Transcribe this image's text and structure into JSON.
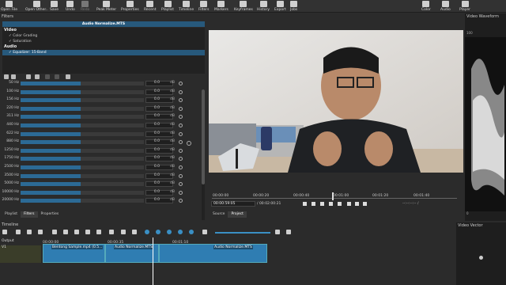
{
  "toolbar": {
    "items": [
      {
        "label": "Open File",
        "icon": "folder-icon"
      },
      {
        "label": "Open Other..",
        "icon": "open-other-icon"
      },
      {
        "label": "Save",
        "icon": "save-icon"
      },
      {
        "label": "Undo",
        "icon": "undo-icon"
      },
      {
        "label": "Redo",
        "icon": "redo-icon"
      },
      {
        "label": "Peak Meter",
        "icon": "peak-meter-icon"
      },
      {
        "label": "Properties",
        "icon": "properties-icon"
      },
      {
        "label": "Recent",
        "icon": "recent-icon"
      },
      {
        "label": "Playlist",
        "icon": "playlist-icon"
      },
      {
        "label": "Timeline",
        "icon": "timeline-icon"
      },
      {
        "label": "Filters",
        "icon": "filters-icon"
      },
      {
        "label": "Markers",
        "icon": "markers-icon"
      },
      {
        "label": "Keyframes",
        "icon": "keyframes-icon"
      },
      {
        "label": "History",
        "icon": "history-icon"
      },
      {
        "label": "Export",
        "icon": "export-icon"
      },
      {
        "label": "Jobs",
        "icon": "jobs-icon"
      }
    ],
    "right": [
      {
        "label": "Color"
      },
      {
        "label": "Audio"
      },
      {
        "label": "Player"
      }
    ]
  },
  "filters": {
    "title": "Filters",
    "file": "Audio Normalize.MTS",
    "video_group": "Video",
    "video_items": [
      "Color Grading",
      "Saturation"
    ],
    "audio_group": "Audio",
    "audio_items": [
      "Equalizer: 15-Band"
    ]
  },
  "eq": {
    "unit": "dB",
    "bands": [
      {
        "label": "50 Hz",
        "value": "0.0"
      },
      {
        "label": "100 Hz",
        "value": "0.0"
      },
      {
        "label": "156 Hz",
        "value": "0.0"
      },
      {
        "label": "220 Hz",
        "value": "0.0"
      },
      {
        "label": "311 Hz",
        "value": "0.0"
      },
      {
        "label": "440 Hz",
        "value": "0.0"
      },
      {
        "label": "622 Hz",
        "value": "0.0"
      },
      {
        "label": "880 Hz",
        "value": "0.0"
      },
      {
        "label": "1250 Hz",
        "value": "0.0"
      },
      {
        "label": "1750 Hz",
        "value": "0.0"
      },
      {
        "label": "2500 Hz",
        "value": "0.0"
      },
      {
        "label": "3500 Hz",
        "value": "0.0"
      },
      {
        "label": "5000 Hz",
        "value": "0.0"
      },
      {
        "label": "10000 Hz",
        "value": "0.0"
      },
      {
        "label": "20000 Hz",
        "value": "0.0"
      }
    ]
  },
  "left_tabs": [
    "Playlist",
    "Filters",
    "Properties"
  ],
  "player": {
    "ruler": [
      "00:00:00",
      "00:00:20",
      "00:00:40",
      "00:01:00",
      "00:01:20",
      "00:01:40"
    ],
    "position": "00:00:59:05",
    "duration": "/ 00:02:00:21",
    "in_out": "--:--:--:-- /",
    "tabs": [
      "Source",
      "Project"
    ]
  },
  "scope": {
    "title": "Video Waveform",
    "top": "100",
    "bottom": "0"
  },
  "timeline": {
    "title": "Timeline",
    "ruler": [
      "00:00:00",
      "00:00:35",
      "00:01:10"
    ],
    "tracks": [
      {
        "name": "Output"
      },
      {
        "name": "V1"
      }
    ],
    "clips": [
      "Bentong Sample.mp4 (0.5...",
      "Audio Normalize.MTS",
      "Audio Normalize.MTS"
    ]
  },
  "vector": {
    "title": "Video Vector"
  }
}
